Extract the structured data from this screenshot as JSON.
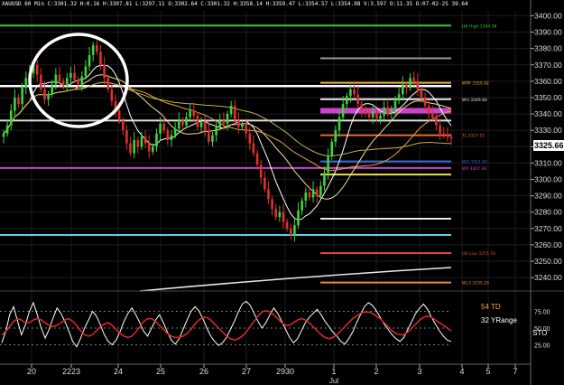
{
  "header": {
    "text": "XAUUSD 60 Min  C:3301.32  H:0.16  H:3307.81  L:3297.11  O:3302.64  C:3301.32  H:3358.14  H:3359.47  L:3354.57  L:3354.98  V:3.597  O:11.35  O:07-02-25  39.64"
  },
  "price_badge": "3325.66",
  "indicator_labels": {
    "td": "54 TD",
    "yrange": "32 YRange",
    "sto": "STO"
  },
  "chart_data": {
    "type": "candlestick",
    "title": "",
    "xlabel": "",
    "ylabel": "",
    "ylim": [
      3234,
      3403
    ],
    "y_ticks": [
      3240,
      3250,
      3260,
      3270,
      3280,
      3290,
      3300,
      3310,
      3320,
      3330,
      3340,
      3350,
      3360,
      3370,
      3380,
      3390,
      3400
    ],
    "x_ticks": [
      "20",
      "2223",
      "24",
      "25",
      "26",
      "27",
      "2930",
      "1",
      "2",
      "3",
      "4",
      "5",
      "7"
    ],
    "x_sublabel": "Jul",
    "last_price": 3325.66,
    "closes": [
      3328,
      3333,
      3342,
      3350,
      3346,
      3356,
      3362,
      3365,
      3370,
      3364,
      3355,
      3349,
      3352,
      3358,
      3364,
      3360,
      3357,
      3362,
      3365,
      3361,
      3358,
      3363,
      3369,
      3376,
      3382,
      3378,
      3370,
      3362,
      3355,
      3348,
      3342,
      3336,
      3330,
      3322,
      3316,
      3324,
      3320,
      3326,
      3322,
      3317,
      3320,
      3328,
      3334,
      3330,
      3324,
      3327,
      3331,
      3336,
      3333,
      3338,
      3342,
      3339,
      3332,
      3335,
      3330,
      3323,
      3327,
      3332,
      3336,
      3334,
      3340,
      3345,
      3336,
      3332,
      3334,
      3328,
      3322,
      3316,
      3309,
      3301,
      3294,
      3288,
      3282,
      3277,
      3280,
      3274,
      3270,
      3266,
      3272,
      3281,
      3287,
      3292,
      3289,
      3294,
      3290,
      3296,
      3304,
      3314,
      3323,
      3330,
      3338,
      3346,
      3351,
      3355,
      3352,
      3346,
      3342,
      3340,
      3338,
      3341,
      3337,
      3339,
      3344,
      3340,
      3343,
      3348,
      3352,
      3358,
      3356,
      3362,
      3360,
      3355,
      3350,
      3345,
      3340,
      3338,
      3333,
      3328,
      3327,
      3326,
      3325
    ],
    "levels": [
      {
        "price": 3394,
        "color": "#37c837",
        "label": "LW High 3394.38"
      },
      {
        "price": 3374,
        "color": "#9a9a9a",
        "label": ""
      },
      {
        "price": 3359,
        "color": "#e8b23a",
        "label": "WPP 3359.92"
      },
      {
        "price": 3357,
        "color": "#ffffff",
        "label": ""
      },
      {
        "price": 3349,
        "color": "#e8e8e8",
        "label": "WH 3349.84"
      },
      {
        "price": 3342,
        "color": "#cc44cc",
        "label": ""
      },
      {
        "price": 3336,
        "color": "#dddddd",
        "label": ""
      },
      {
        "price": 3327,
        "color": "#e86a40",
        "label": "TL 3327.51"
      },
      {
        "price": 3311,
        "color": "#3c6ae0",
        "label": "WO 3311.92"
      },
      {
        "price": 3307,
        "color": "#cc44cc",
        "label": "WP 3307.66"
      },
      {
        "price": 3303,
        "color": "#f0e040",
        "label": ""
      },
      {
        "price": 3276,
        "color": "#e8e8e8",
        "label": ""
      },
      {
        "price": 3266,
        "color": "#52d6e6",
        "label": ""
      },
      {
        "price": 3255,
        "color": "#e24040",
        "label": "LW Low 3255.78"
      },
      {
        "price": 3237,
        "color": "#e88a3a",
        "label": "WL3 3235.20"
      }
    ],
    "stochastic": {
      "levels": [
        75,
        50,
        25
      ],
      "k": [
        28,
        45,
        70,
        82,
        60,
        40,
        55,
        75,
        88,
        70,
        50,
        35,
        48,
        65,
        80,
        72,
        60,
        45,
        30,
        22,
        35,
        50,
        62,
        75,
        68,
        55,
        40,
        30,
        25,
        32,
        45,
        60,
        72,
        80,
        70,
        58,
        45,
        38,
        50,
        62,
        70,
        58,
        44,
        32,
        26,
        34,
        48,
        62,
        75,
        82,
        76,
        64,
        50,
        38,
        30,
        24,
        28,
        36,
        48,
        60,
        74,
        86,
        90,
        84,
        72,
        60,
        50,
        58,
        70,
        80,
        72,
        60,
        48,
        36,
        28,
        34,
        46,
        58,
        66,
        72,
        78,
        70,
        60,
        52,
        44,
        38,
        30,
        26,
        34,
        44,
        58,
        70,
        82,
        88,
        84,
        76,
        66,
        56,
        48,
        40,
        34,
        30,
        36,
        48,
        60,
        72,
        80,
        86,
        78,
        66,
        56,
        46,
        38,
        32,
        30
      ],
      "d": [
        40,
        45,
        52,
        60,
        64,
        62,
        58,
        58,
        62,
        64,
        62,
        58,
        54,
        52,
        54,
        58,
        62,
        64,
        60,
        54,
        46,
        40,
        38,
        40,
        46,
        52,
        56,
        58,
        54,
        48,
        42,
        38,
        36,
        38,
        44,
        52,
        60,
        64,
        64,
        60,
        54,
        48,
        42,
        38,
        36,
        36,
        38,
        42,
        48,
        56,
        62,
        66,
        66,
        62,
        56,
        50,
        44,
        38,
        34,
        32,
        34,
        38,
        44,
        52,
        60,
        68,
        74,
        76,
        74,
        70,
        64,
        58,
        54,
        54,
        58,
        62,
        64,
        62,
        58,
        52,
        46,
        40,
        36,
        34,
        36,
        40,
        46,
        52,
        58,
        64,
        68,
        72,
        74,
        74,
        72,
        68,
        64,
        58,
        52,
        46,
        42,
        40,
        40,
        44,
        50,
        56,
        62,
        66,
        68,
        66,
        62,
        58,
        54,
        50,
        46
      ]
    }
  }
}
